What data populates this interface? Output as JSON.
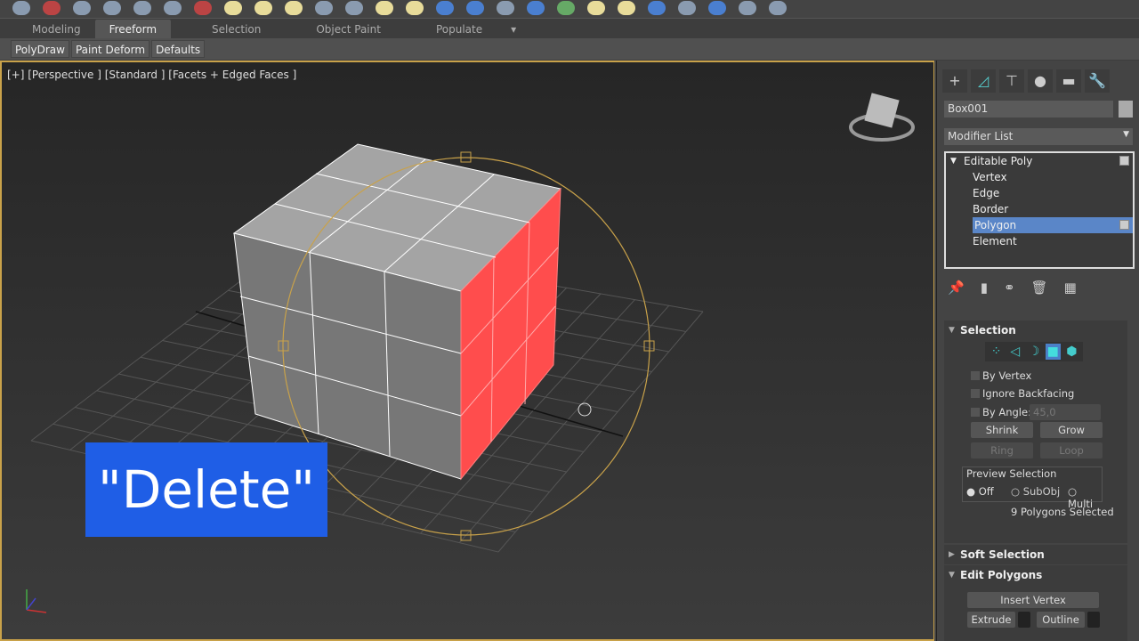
{
  "toolbar": {
    "icons": [
      "teapot-icon",
      "material-icon",
      "render-setup-icon",
      "render-frame-icon",
      "light-icon",
      "camera-icon",
      "help-icon"
    ]
  },
  "ribbon": {
    "tabs": [
      "Modeling",
      "Freeform",
      "Selection",
      "Object Paint",
      "Populate"
    ],
    "active_tab": "Freeform",
    "subtabs": [
      "PolyDraw",
      "Paint Deform",
      "Defaults"
    ]
  },
  "viewport": {
    "label": "[+] [Perspective ] [Standard ] [Facets + Edged Faces ]",
    "overlay_text": "\"Delete\"",
    "selected_color": "#ff4d4d",
    "gizmo_color": "#c9a24a"
  },
  "panel": {
    "object_name": "Box001",
    "modifier_list": "Modifier List",
    "stack": {
      "root": "Editable Poly",
      "items": [
        "Vertex",
        "Edge",
        "Border",
        "Polygon",
        "Element"
      ],
      "selected": "Polygon"
    },
    "selection": {
      "title": "Selection",
      "by_vertex": "By Vertex",
      "ignore_backfacing": "Ignore Backfacing",
      "by_angle": "By Angle:",
      "angle_value": "45,0",
      "shrink": "Shrink",
      "grow": "Grow",
      "ring": "Ring",
      "loop": "Loop",
      "preview_title": "Preview Selection",
      "preview_options": [
        "Off",
        "SubObj",
        "Multi"
      ],
      "preview_selected": "Off",
      "status": "9 Polygons Selected"
    },
    "soft_selection": "Soft Selection",
    "edit_polygons": {
      "title": "Edit Polygons",
      "insert_vertex": "Insert Vertex",
      "extrude": "Extrude",
      "outline": "Outline"
    }
  }
}
